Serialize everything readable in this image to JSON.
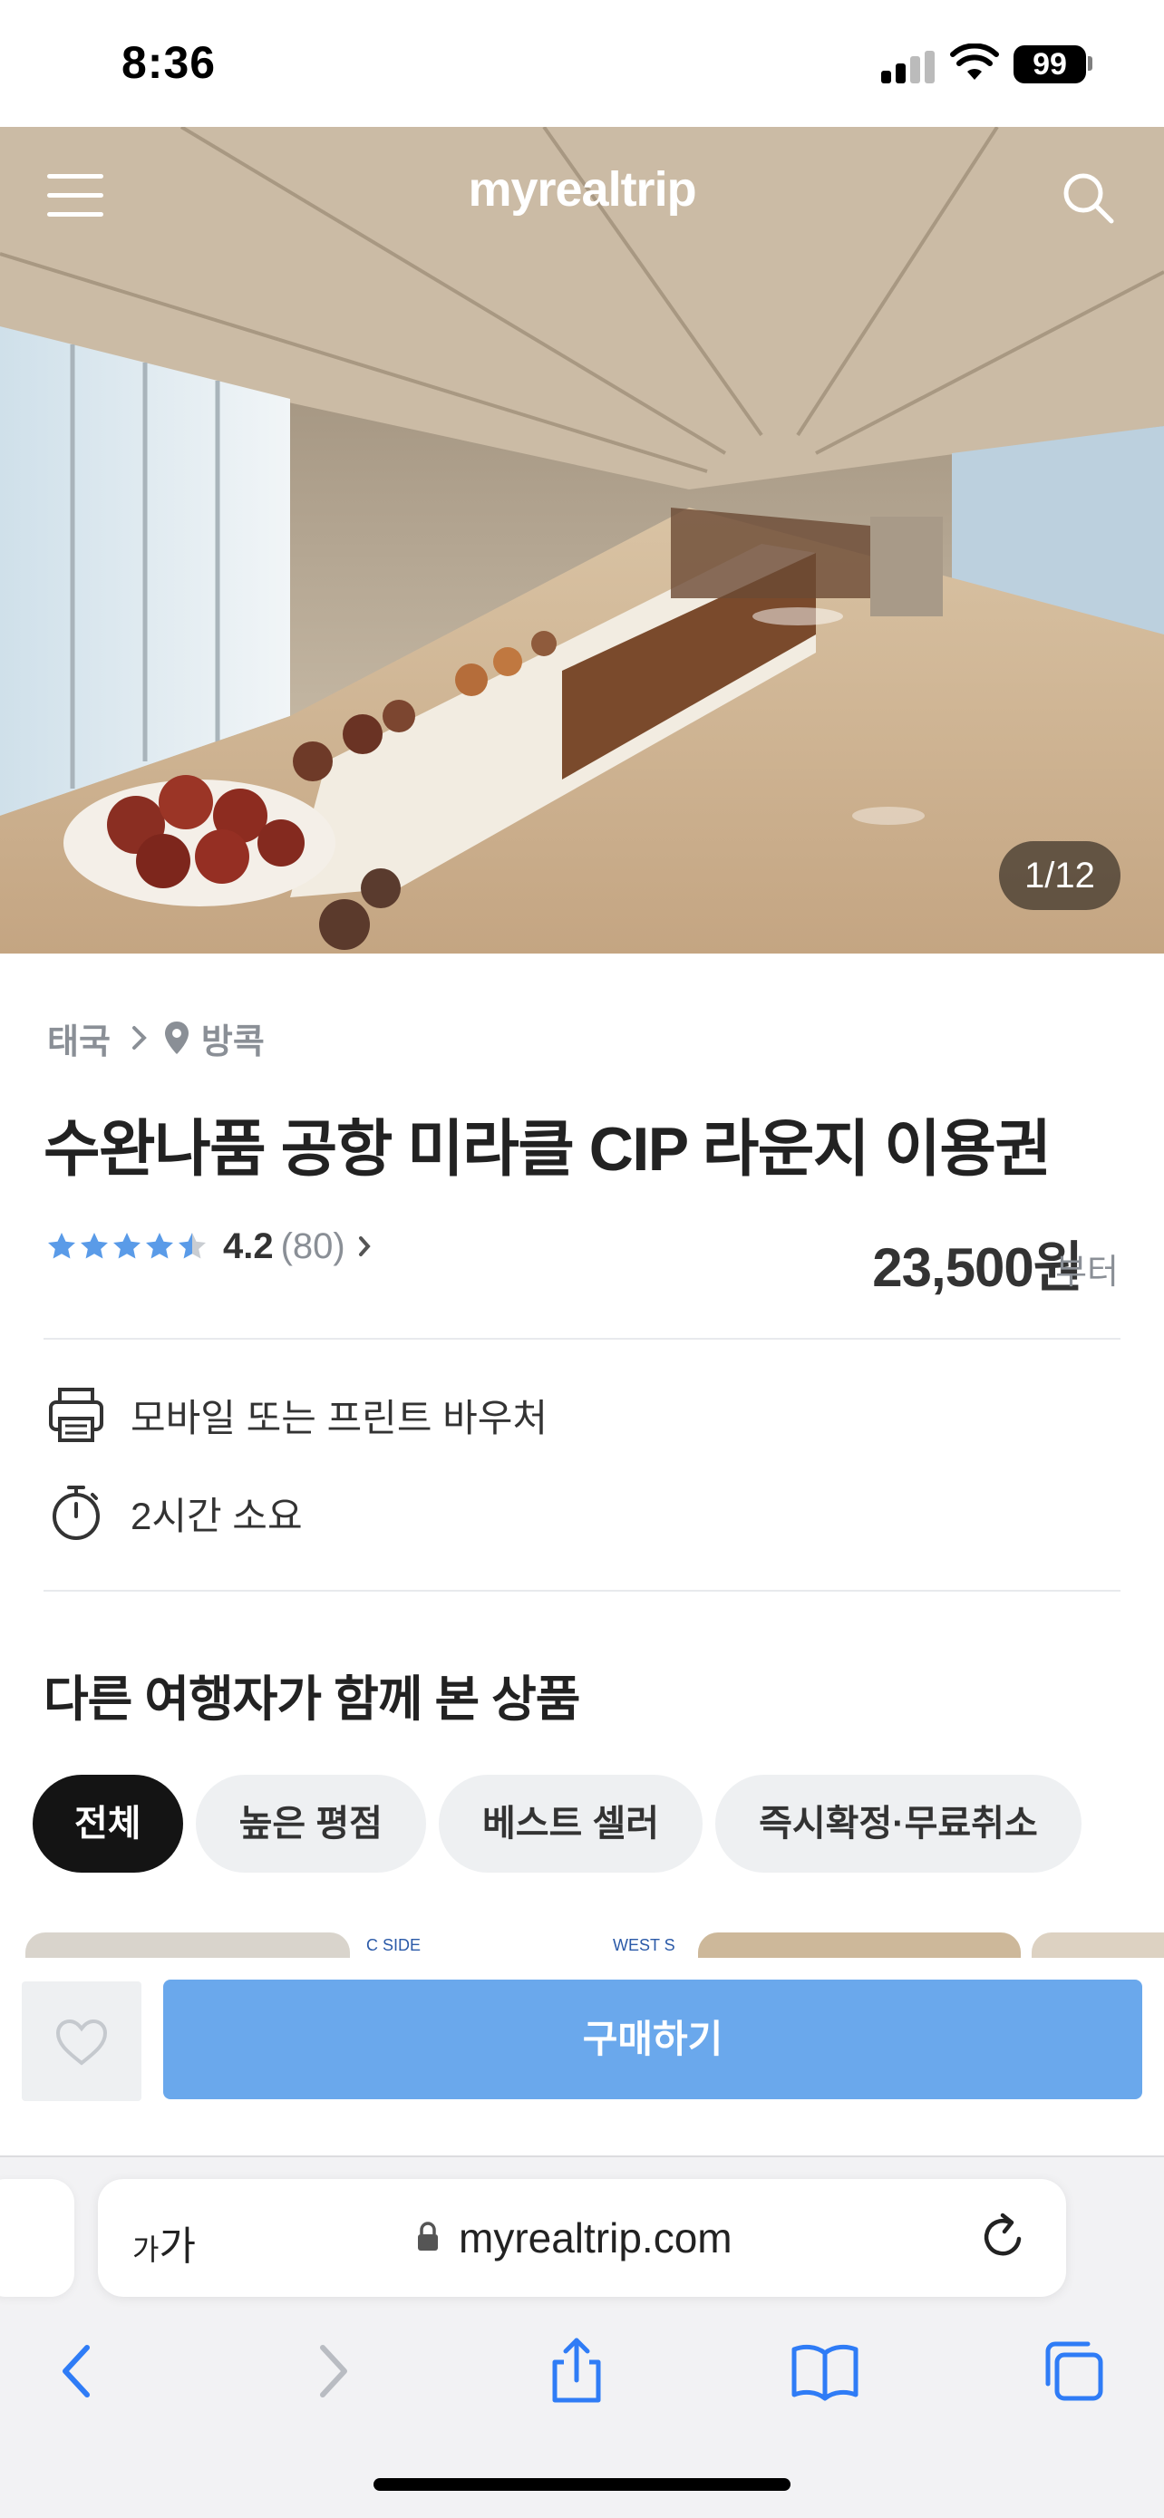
{
  "status_bar": {
    "time": "8:36",
    "battery": "99"
  },
  "header": {
    "logo": "myrealtrip",
    "menu_icon": "hamburger-icon",
    "search_icon": "search-icon"
  },
  "gallery": {
    "counter": "1/12"
  },
  "breadcrumb": {
    "country": "태국",
    "city": "방콕"
  },
  "product": {
    "title": "수완나품 공항 미라클 CIP 라운지 이용권",
    "rating": {
      "score": "4.2",
      "count": "(80)",
      "stars": 4.2
    },
    "price": "23,500원",
    "price_suffix": "부터"
  },
  "info": [
    {
      "icon": "printer-icon",
      "text": "모바일 또는 프린트 바우처"
    },
    {
      "icon": "stopwatch-icon",
      "text": "2시간 소요"
    }
  ],
  "related": {
    "title": "다른 여행자가 함께 본 상품",
    "chips": [
      "전체",
      "높은 평점",
      "베스트 셀러",
      "즉시확정·무료취소"
    ],
    "thumb_texts": [
      "C SIDE",
      "WEST S"
    ]
  },
  "buybar": {
    "buy_label": "구매하기"
  },
  "browser": {
    "text_size_small": "가",
    "text_size_large": "가",
    "url": "myrealtrip.com"
  },
  "colors": {
    "accent": "#6aa8ec",
    "star": "#5a9be8",
    "chip_active": "#141414"
  }
}
